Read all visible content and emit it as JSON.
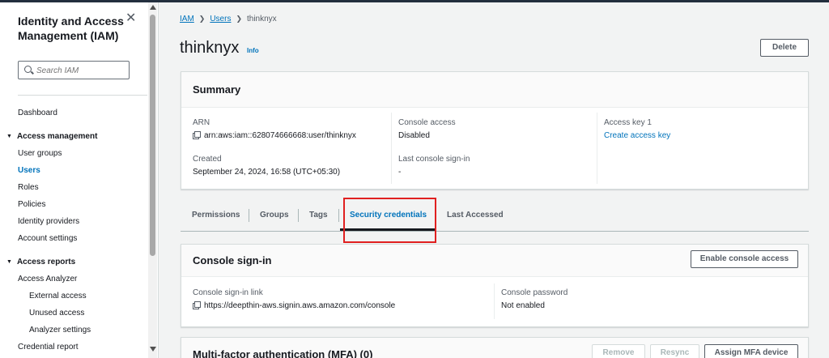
{
  "sidebar": {
    "title": "Identity and Access Management (IAM)",
    "close_icon": "close-icon",
    "search_placeholder": "Search IAM",
    "dashboard": "Dashboard",
    "access_management": {
      "label": "Access management",
      "items": [
        "User groups",
        "Users",
        "Roles",
        "Policies",
        "Identity providers",
        "Account settings"
      ],
      "active": "Users"
    },
    "access_reports": {
      "label": "Access reports",
      "items": [
        "Access Analyzer",
        "External access",
        "Unused access",
        "Analyzer settings",
        "Credential report"
      ]
    }
  },
  "breadcrumb": {
    "items": [
      "IAM",
      "Users"
    ],
    "current": "thinknyx"
  },
  "page": {
    "title": "thinknyx",
    "info": "Info",
    "delete_label": "Delete"
  },
  "summary": {
    "heading": "Summary",
    "arn_label": "ARN",
    "arn_value": "arn:aws:iam::628074666668:user/thinknyx",
    "created_label": "Created",
    "created_value": "September 24, 2024, 16:58 (UTC+05:30)",
    "console_access_label": "Console access",
    "console_access_value": "Disabled",
    "last_signin_label": "Last console sign-in",
    "last_signin_value": "-",
    "access_key_label": "Access key 1",
    "access_key_link": "Create access key"
  },
  "tabs": {
    "items": [
      "Permissions",
      "Groups",
      "Tags",
      "Security credentials",
      "Last Accessed"
    ],
    "active": "Security credentials"
  },
  "console_signin": {
    "heading": "Console sign-in",
    "enable_label": "Enable console access",
    "link_label": "Console sign-in link",
    "link_value": "https://deepthin-aws.signin.aws.amazon.com/console",
    "password_label": "Console password",
    "password_value": "Not enabled"
  },
  "mfa": {
    "heading": "Multi-factor authentication (MFA) (0)",
    "remove_label": "Remove",
    "resync_label": "Resync",
    "assign_label": "Assign MFA device"
  },
  "colors": {
    "link": "#0073bb",
    "highlight": "#e02020",
    "nav_dark": "#232f3e"
  }
}
